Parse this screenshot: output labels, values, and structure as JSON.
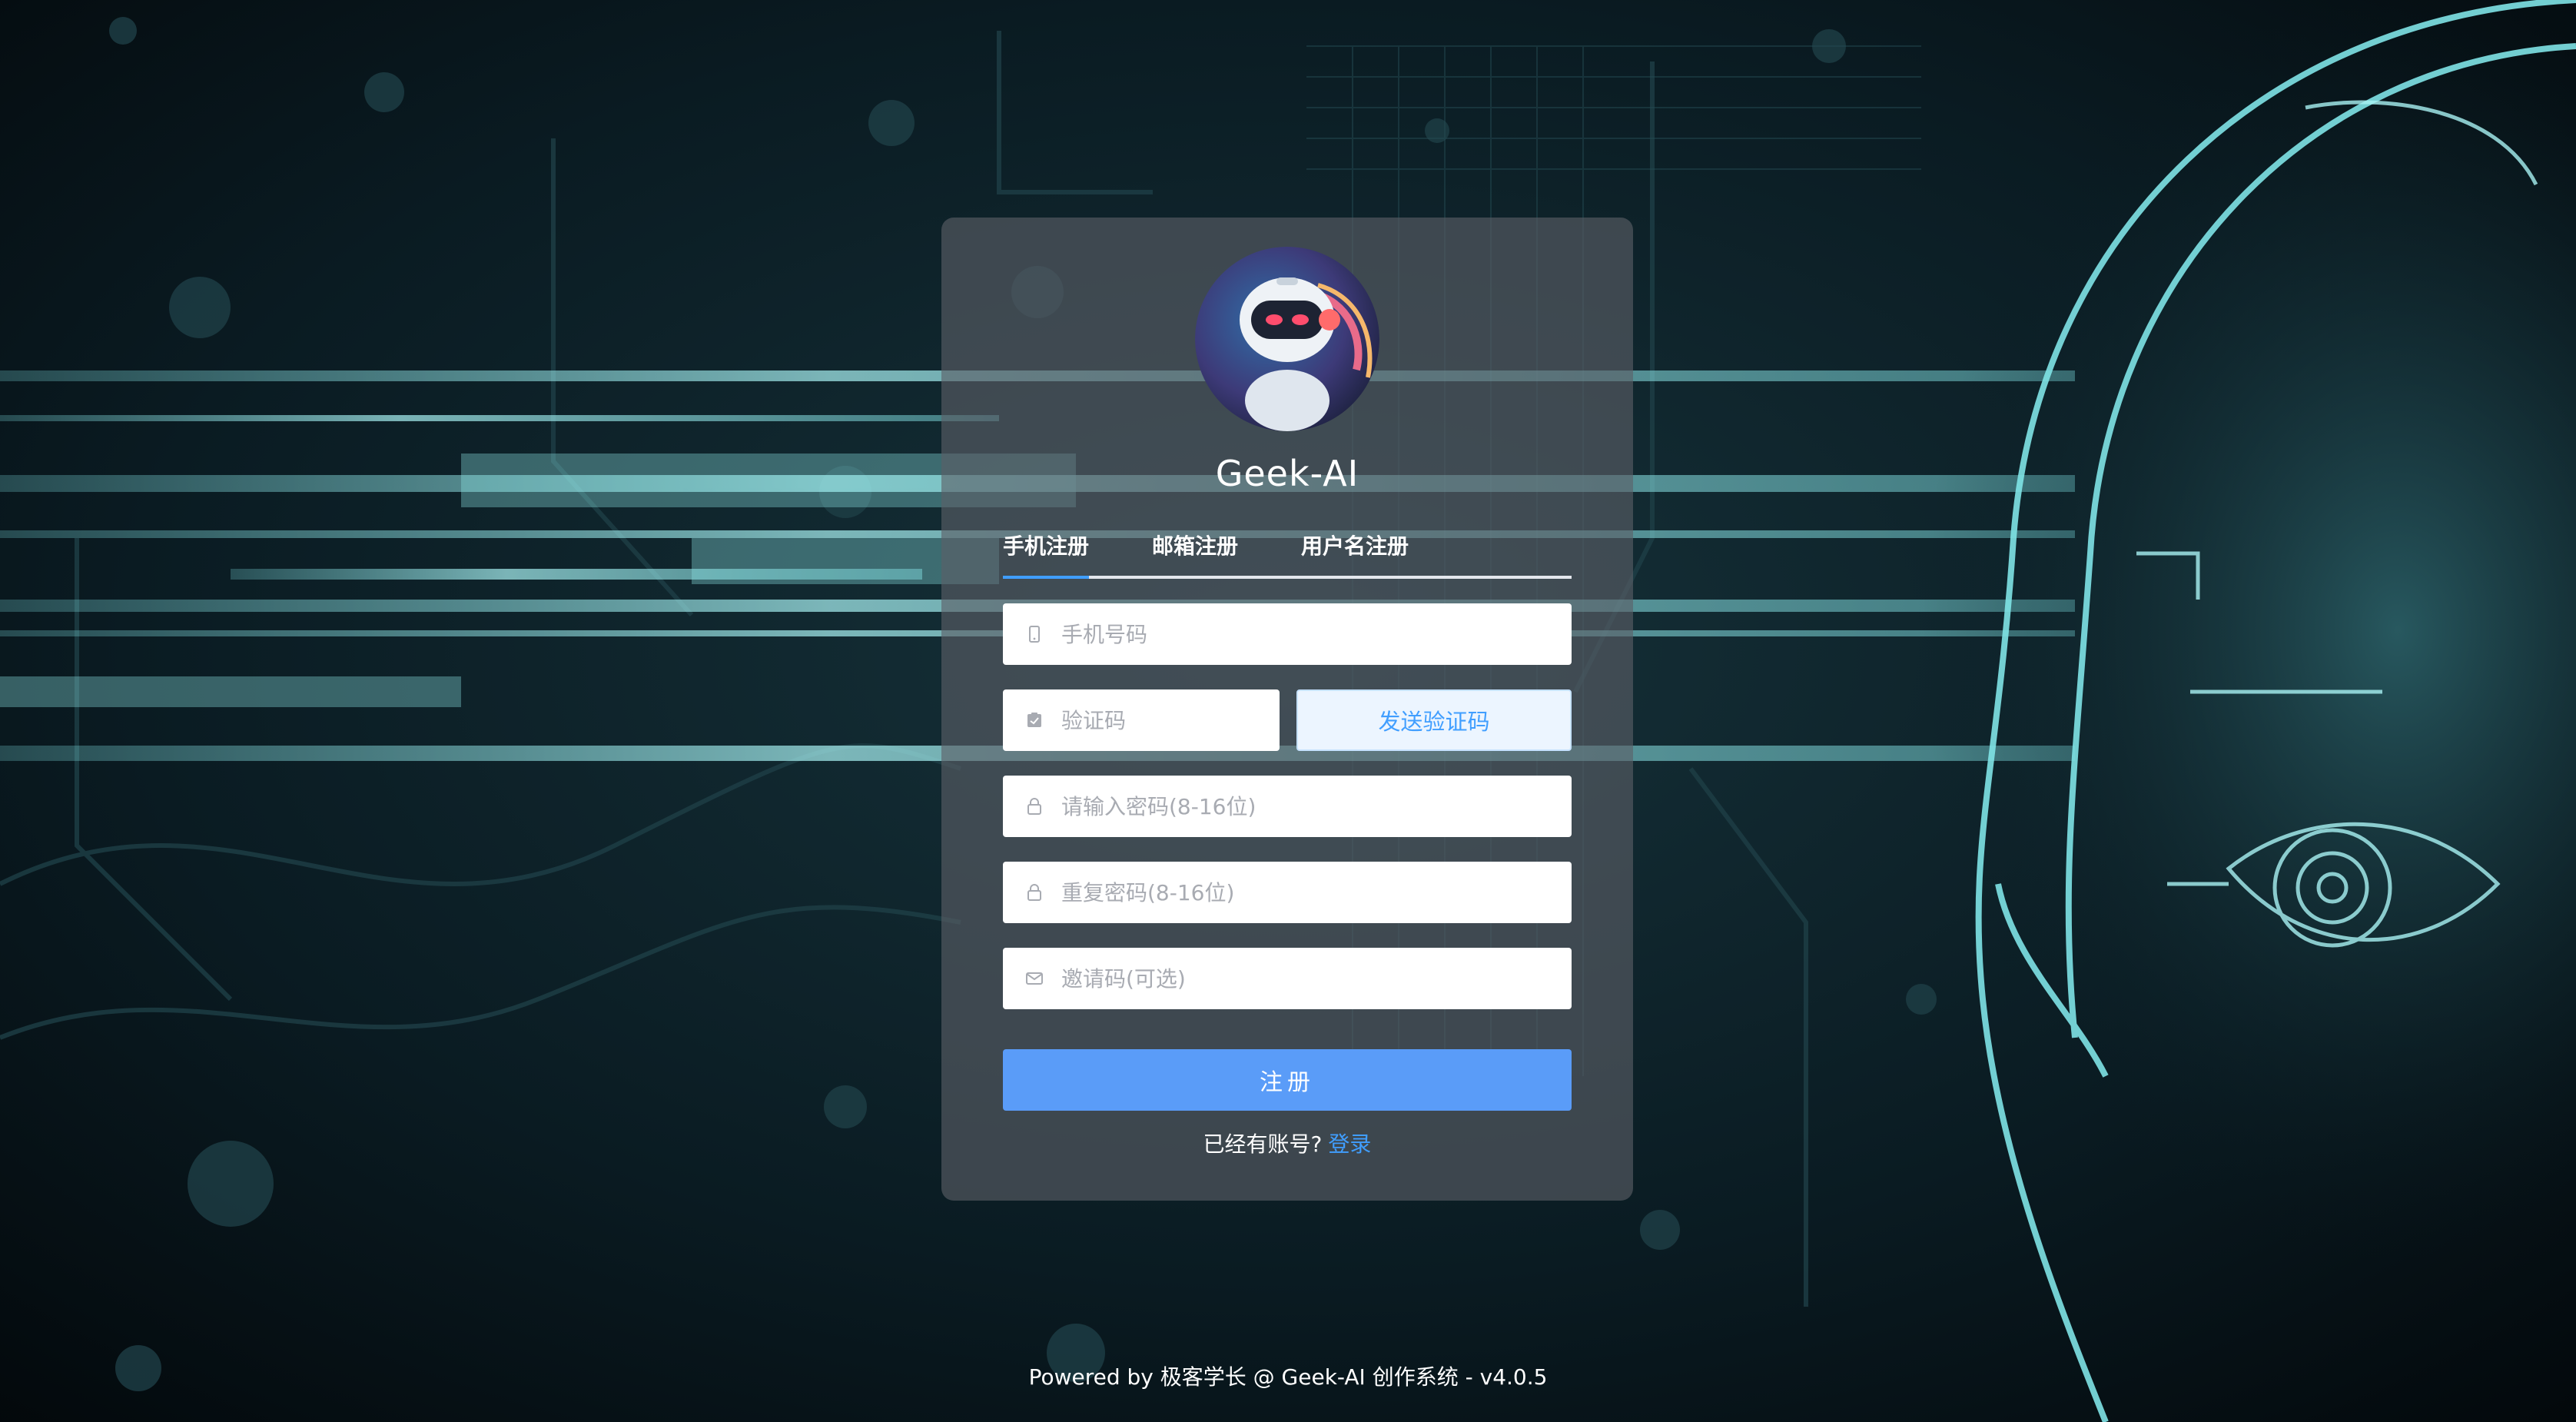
{
  "brand": {
    "name": "Geek-AI"
  },
  "tabs": [
    {
      "label": "手机注册",
      "active": true
    },
    {
      "label": "邮箱注册",
      "active": false
    },
    {
      "label": "用户名注册",
      "active": false
    }
  ],
  "form": {
    "phone": {
      "placeholder": "手机号码",
      "value": "",
      "icon": "mobile-icon"
    },
    "code": {
      "placeholder": "验证码",
      "value": "",
      "icon": "verify-icon"
    },
    "send_code_label": "发送验证码",
    "password": {
      "placeholder": "请输入密码(8-16位)",
      "value": "",
      "icon": "lock-icon"
    },
    "repeat_password": {
      "placeholder": "重复密码(8-16位)",
      "value": "",
      "icon": "lock-icon"
    },
    "invite": {
      "placeholder": "邀请码(可选)",
      "value": "",
      "icon": "mail-icon"
    },
    "submit_label": "注册"
  },
  "login_prompt": {
    "text": "已经有账号?",
    "link": "登录"
  },
  "footer": {
    "text": "Powered by 极客学长 @ Geek-AI 创作系统 - v4.0.5"
  },
  "colors": {
    "accent": "#409eff",
    "submit": "#5a9cf8",
    "panel": "#5c6068",
    "background": "#050d12",
    "glow": "#7fe3e6"
  }
}
